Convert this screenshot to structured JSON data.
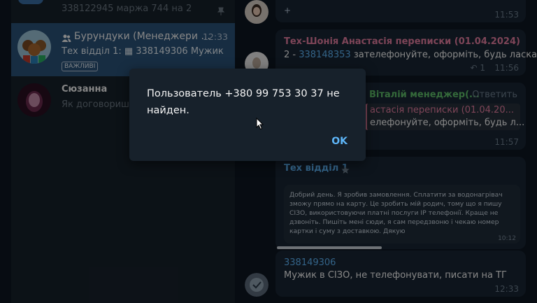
{
  "chats": [
    {
      "name": "",
      "time": "",
      "message": "338122945 маржа 744 на 2",
      "pinned": true
    },
    {
      "name": "Бурундуки (Менеджери ...",
      "time": "12:33",
      "message": "Тех відділ 1: ▦ 338149306 Мужик ...",
      "badge": "ВАЖЛИВІ",
      "active": true
    },
    {
      "name": "Сюзанна",
      "time": "",
      "message": "Як договориш ..."
    }
  ],
  "messages": {
    "m0": {
      "text": "+",
      "time": "11:53"
    },
    "m1": {
      "sender": "Тех-Шонія Анастасія переписки (01.04.2024)",
      "prefix": "2 - ",
      "link": "338148353",
      "text": " зателефонуйте, оформіть, будь ласка",
      "reactions": "↶ 1",
      "time": "11:56"
    },
    "m2": {
      "sender": "Віталій менеджер(...",
      "reply_label": "Ответить",
      "quote_title": "астасія переписки (01.04.20...",
      "quote_text": "елефонуйте, оформіть, будь л...",
      "time": "11:57"
    },
    "m3": {
      "sender": "Тех відділ 1",
      "screenshot_text": "Добрий день. Я зробив замовлення. Сплатити за водонагрівач зможу прямо на карту. Це зробить мій родич, тому що я пишу СІЗО, використовуючи платні послуги IP телефонії. Краще не дзвоніть. Пишіть мені сюди, я сам передзвоню і чекаю номер картки і суму з доставкою. Дякую",
      "screenshot_time": "10:12"
    },
    "m4": {
      "link": "338149306",
      "text": "Мужик в СІЗО, не телефонувати, писати на ТГ",
      "time": "12:33"
    }
  },
  "dialog": {
    "text": "Пользователь +380 99 753 30 37 не найден.",
    "ok_label": "OK"
  },
  "colors": {
    "accent": "#5eb5f7",
    "sender_pink": "#e57ea0",
    "sender_green": "#5fbf6a",
    "active_chat": "#2b5278"
  }
}
